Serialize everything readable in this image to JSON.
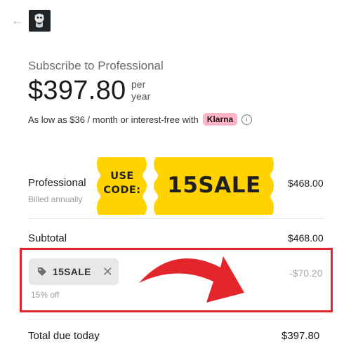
{
  "header": {
    "back_icon": "back-arrow-icon",
    "logo_icon": "brand-logo-icon"
  },
  "summary": {
    "title": "Subscribe to Professional",
    "price": "$397.80",
    "per_line1": "per",
    "per_line2": "year",
    "installment_text": "As low as $36 / month or interest-free with",
    "klarna_label": "Klarna",
    "info_glyph": "i"
  },
  "line_item": {
    "name": "Professional",
    "billing": "Billed annually",
    "price": "$468.00"
  },
  "ticket": {
    "line1": "USE",
    "line2": "CODE:",
    "code": "15SALE",
    "color": "#ffd200"
  },
  "subtotal": {
    "label": "Subtotal",
    "value": "$468.00"
  },
  "promo": {
    "code": "15SALE",
    "remove_glyph": "✕",
    "description": "15% off",
    "discount": "-$70.20",
    "highlight_color": "#e3262b"
  },
  "total": {
    "label": "Total due today",
    "value": "$397.80"
  }
}
